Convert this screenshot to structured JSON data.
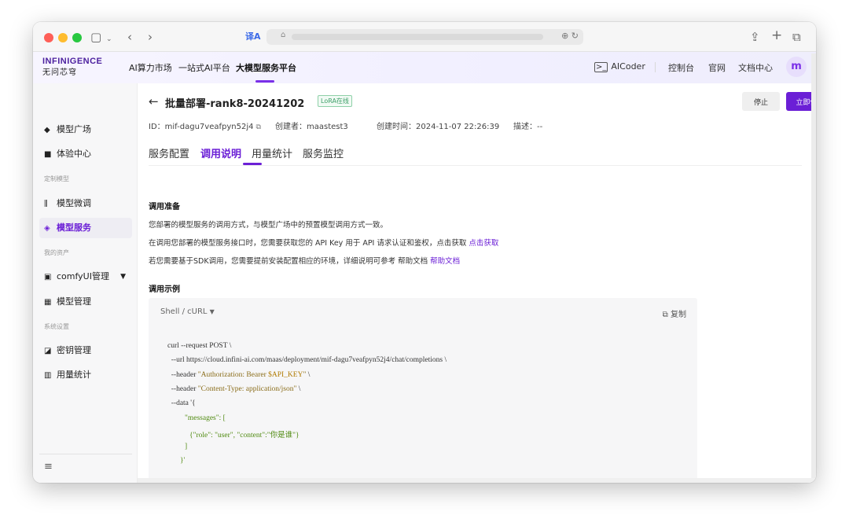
{
  "browser": {
    "translate_icon": "译A",
    "lock_icon": "🔒",
    "url_right_icons": "⊕ ↻"
  },
  "logo": {
    "line1": "INFINIGENCE",
    "line2": "无问芯穹"
  },
  "topnav": {
    "items": [
      "AI算力市场",
      "一站式AI平台",
      "大模型服务平台"
    ],
    "aicoder": "AICoder",
    "console": "控制台",
    "official": "官网",
    "docs": "文档中心",
    "avatar_letter": "m"
  },
  "sidebar": {
    "items": {
      "model_square": "模型广场",
      "experience": "体验中心",
      "group_custom": "定制模型",
      "finetune": "模型微调",
      "model_service": "模型服务",
      "group_assets": "我的资产",
      "comfyui": "comfyUI管理",
      "model_manage": "模型管理",
      "group_settings": "系统设置",
      "key_manage": "密钥管理",
      "usage": "用量统计"
    }
  },
  "header": {
    "back": "←",
    "title": "批量部署-rank8-20241202",
    "tag": "LoRA在线",
    "stop": "停止",
    "try_now": "立即体验",
    "id": "ID：mif-dagu7veafpyn52j4",
    "creator": "创建者：maastest3",
    "created_at": "创建时间：2024-11-07 22:26:39",
    "description": "描述：--"
  },
  "tabs": [
    "服务配置",
    "调用说明",
    "用量统计",
    "服务监控"
  ],
  "content": {
    "prep_title": "调用准备",
    "p1": "您部署的模型服务的调用方式，与模型广场中的预置模型调用方式一致。",
    "p2": "在调用您部署的模型服务接口时，您需要获取您的 API Key 用于 API 请求认证和鉴权，点击获取 ",
    "p2_link": "点击获取",
    "p3": "若您需要基于SDK调用，您需要提前安装配置相应的环境，详细说明可参考 帮助文档 ",
    "p3_link": "帮助文档",
    "example_title": "调用示例",
    "lang_select": "Shell / cURL",
    "copy": "复制"
  },
  "code": {
    "l1": "curl --request POST \\",
    "l2": "  --url https://cloud.infini-ai.com/maas/deployment/mif-dagu7veafpyn52j4/chat/completions \\",
    "l3a": "  --header ",
    "l3b": "\"Authorization: Bearer ",
    "l3c": "$API_KEY",
    "l3d": "\"",
    "l3e": " \\",
    "l4a": "  --header ",
    "l4b": "\"Content-Type: application/json\"",
    "l4c": " \\",
    "l5": "  --data '{",
    "l6": "\"messages\": [",
    "l7": "{\"role\": \"user\", \"content\":\"你是谁\"}",
    "l8": "]",
    "l9": "}'"
  },
  "colors": {
    "accent": "#6b1fd6",
    "tag_green": "#3fa06a"
  }
}
